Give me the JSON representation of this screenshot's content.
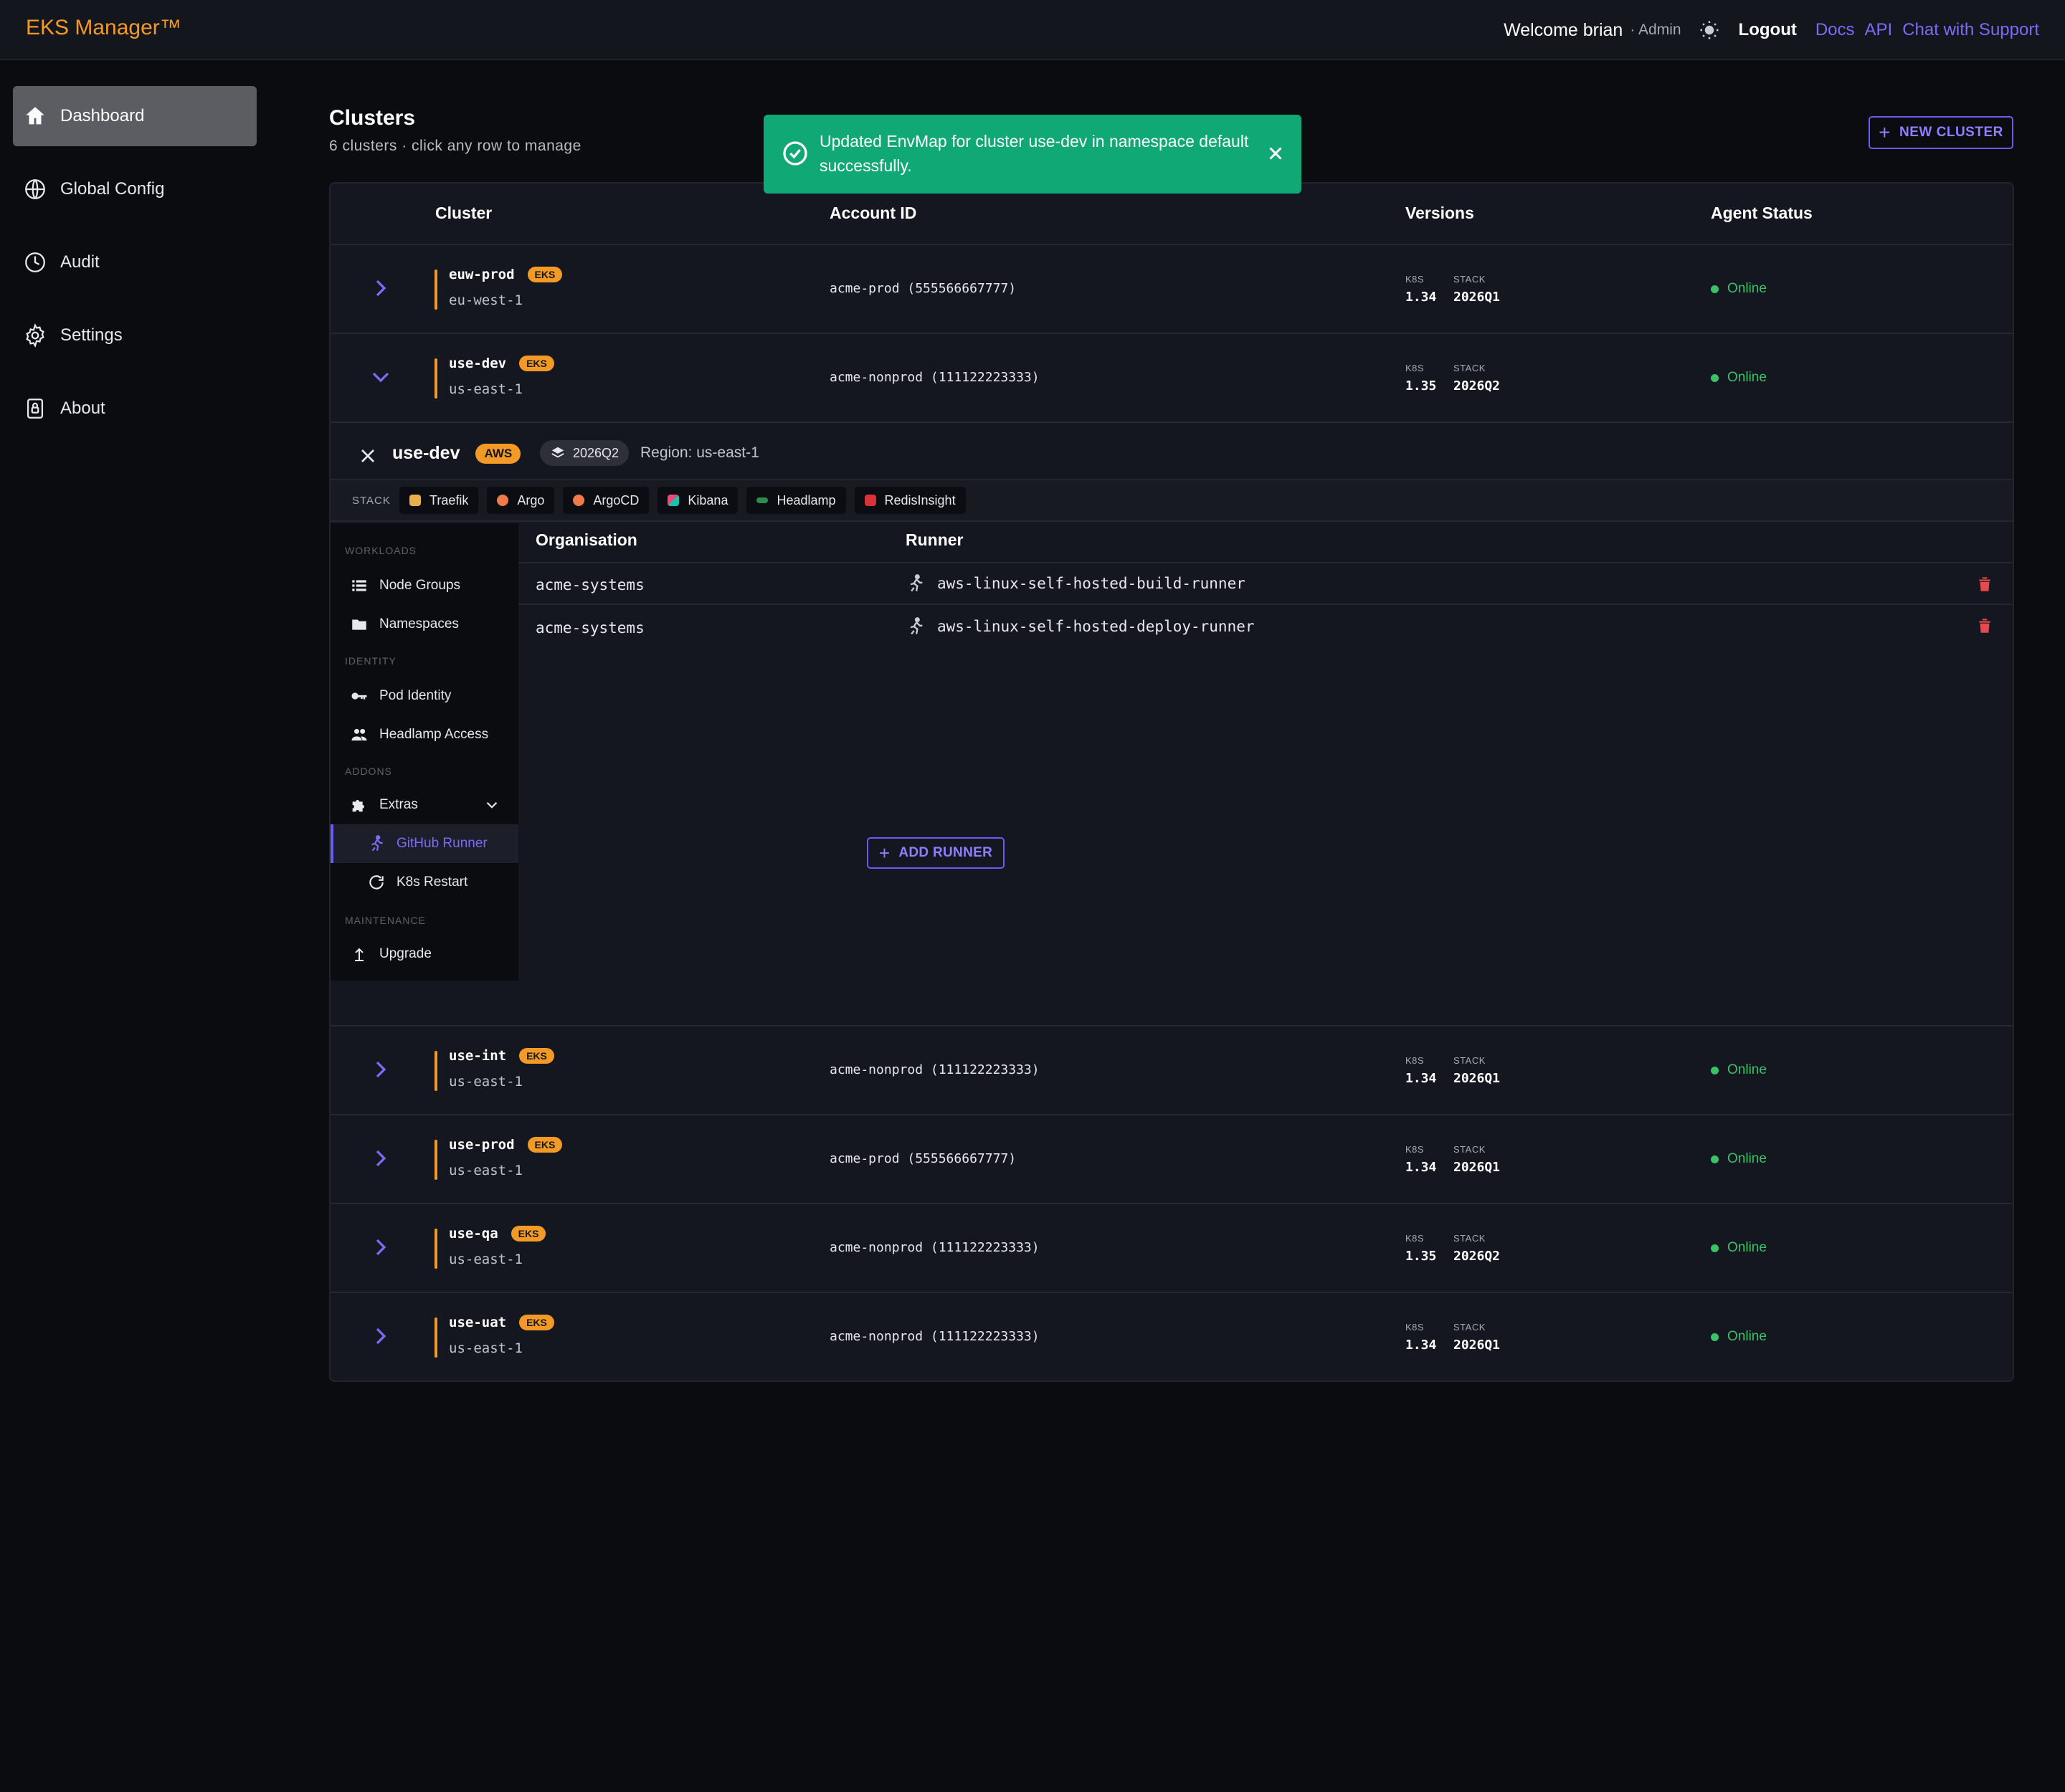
{
  "app": {
    "brand": "EKS Manager™",
    "welcome": "Welcome brian",
    "role": "· Admin",
    "logout": "Logout",
    "links": [
      "Docs",
      "API",
      "Chat with Support"
    ]
  },
  "sidebar": {
    "items": [
      {
        "label": "Dashboard",
        "icon": "home-icon",
        "active": true
      },
      {
        "label": "Global Config",
        "icon": "globe-icon"
      },
      {
        "label": "Audit",
        "icon": "clock-icon"
      },
      {
        "label": "Settings",
        "icon": "gear-icon"
      },
      {
        "label": "About",
        "icon": "lock-icon"
      }
    ]
  },
  "page": {
    "title": "Clusters",
    "subtitle": "6 clusters · click any row to manage",
    "new_cluster": "NEW CLUSTER"
  },
  "toast": {
    "message": "Updated EnvMap for cluster use-dev in namespace default successfully.",
    "color": "#10a874"
  },
  "table": {
    "headers": {
      "cluster": "Cluster",
      "account": "Account ID",
      "versions": "Versions",
      "status": "Agent Status"
    },
    "k8s_label": "K8S",
    "stack_label": "STACK",
    "rows": [
      {
        "name": "euw-prod",
        "badge": "EKS",
        "region": "eu-west-1",
        "account": "acme-prod (555566667777)",
        "k8s": "1.34",
        "stack": "2026Q1",
        "status": "Online",
        "expanded": false
      },
      {
        "name": "use-dev",
        "badge": "EKS",
        "region": "us-east-1",
        "account": "acme-nonprod (111122223333)",
        "k8s": "1.35",
        "stack": "2026Q2",
        "status": "Online",
        "expanded": true
      },
      {
        "name": "use-int",
        "badge": "EKS",
        "region": "us-east-1",
        "account": "acme-nonprod (111122223333)",
        "k8s": "1.34",
        "stack": "2026Q1",
        "status": "Online",
        "expanded": false
      },
      {
        "name": "use-prod",
        "badge": "EKS",
        "region": "us-east-1",
        "account": "acme-prod (555566667777)",
        "k8s": "1.34",
        "stack": "2026Q1",
        "status": "Online",
        "expanded": false
      },
      {
        "name": "use-qa",
        "badge": "EKS",
        "region": "us-east-1",
        "account": "acme-nonprod (111122223333)",
        "k8s": "1.35",
        "stack": "2026Q2",
        "status": "Online",
        "expanded": false
      },
      {
        "name": "use-uat",
        "badge": "EKS",
        "region": "us-east-1",
        "account": "acme-nonprod (111122223333)",
        "k8s": "1.34",
        "stack": "2026Q1",
        "status": "Online",
        "expanded": false
      }
    ]
  },
  "detail": {
    "name": "use-dev",
    "provider": "AWS",
    "stack": "2026Q2",
    "region": "Region: us-east-1",
    "stack_label": "STACK",
    "chips": [
      {
        "label": "Traefik",
        "color": "#e8b04a"
      },
      {
        "label": "Argo",
        "color": "#f07a4a"
      },
      {
        "label": "ArgoCD",
        "color": "#f07a4a"
      },
      {
        "label": "Kibana",
        "color": "#f0487a"
      },
      {
        "label": "Headlamp",
        "color": "#2f8a4e"
      },
      {
        "label": "RedisInsight",
        "color": "#d8333a"
      }
    ],
    "nav": {
      "sections": {
        "workloads": "WORKLOADS",
        "identity": "IDENTITY",
        "addons": "ADDONS",
        "maintenance": "MAINTENANCE"
      },
      "node_groups": "Node Groups",
      "namespaces": "Namespaces",
      "pod_identity": "Pod Identity",
      "headlamp_access": "Headlamp Access",
      "extras": "Extras",
      "github_runner": "GitHub Runner",
      "k8s_restart": "K8s Restart",
      "upgrade": "Upgrade"
    },
    "runners": {
      "headers": {
        "org": "Organisation",
        "runner": "Runner"
      },
      "rows": [
        {
          "org": "acme-systems",
          "runner": "aws-linux-self-hosted-build-runner"
        },
        {
          "org": "acme-systems",
          "runner": "aws-linux-self-hosted-deploy-runner"
        }
      ],
      "add": "ADD RUNNER"
    }
  }
}
